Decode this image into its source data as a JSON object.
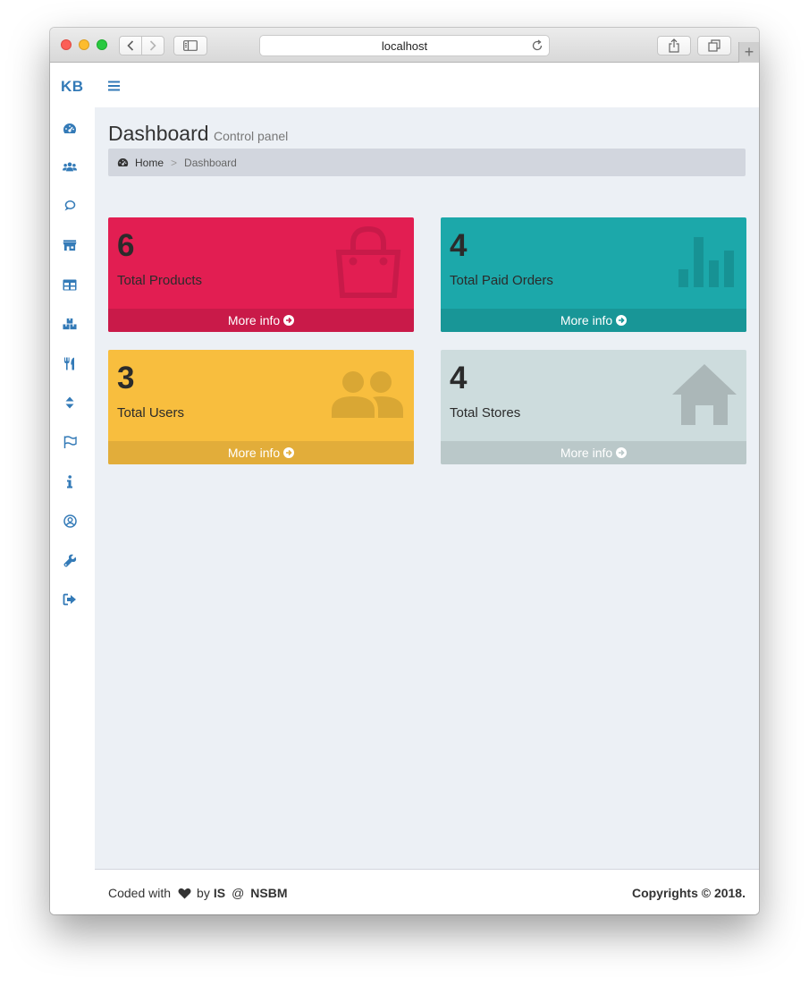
{
  "browser": {
    "url": "localhost"
  },
  "sidebar": {
    "brand": "KB",
    "icons": [
      "dashboard-icon",
      "users-icon",
      "groups-icon",
      "store-icon",
      "table-icon",
      "boxes-icon",
      "cutlery-icon",
      "sort-icon",
      "flag-icon",
      "info-icon",
      "user-circle-icon",
      "wrench-icon",
      "logout-icon"
    ]
  },
  "header": {
    "title": "Dashboard",
    "subtitle": "Control panel"
  },
  "breadcrumb": {
    "home": "Home",
    "separator": ">",
    "current": "Dashboard"
  },
  "stats": [
    {
      "value": "6",
      "label": "Total Products",
      "link": "More info",
      "icon": "shopping-bag-icon",
      "color": "#e21e52",
      "footer_color": "#c91a49"
    },
    {
      "value": "4",
      "label": "Total Paid Orders",
      "link": "More info",
      "icon": "bar-chart-icon",
      "color": "#1ca8aa",
      "footer_color": "#189697"
    },
    {
      "value": "3",
      "label": "Total Users",
      "link": "More info",
      "icon": "users-icon",
      "color": "#f8be3e",
      "footer_color": "#e2ad3a"
    },
    {
      "value": "4",
      "label": "Total Stores",
      "link": "More info",
      "icon": "home-icon",
      "color": "#cddcdd",
      "footer_color": "#bac8c9"
    }
  ],
  "footer": {
    "coded_with": "Coded with",
    "by": "by",
    "author": "IS",
    "at": "@",
    "org": "NSBM",
    "copyright": "Copyrights © 2018."
  },
  "colors": {
    "accent": "#337ab7",
    "content_bg": "#ecf0f5",
    "breadcrumb_bg": "#d2d6de"
  }
}
